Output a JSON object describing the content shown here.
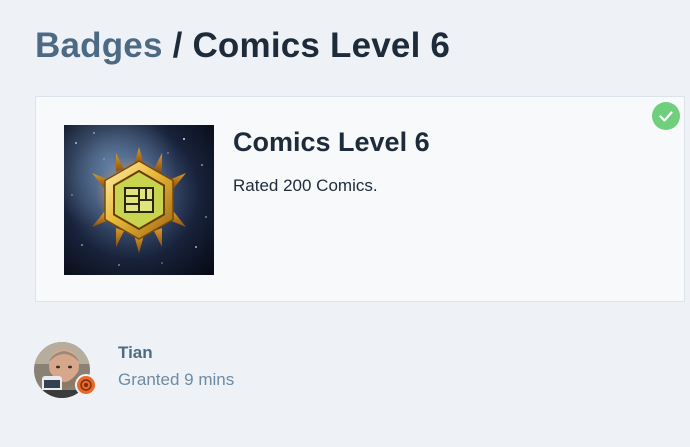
{
  "header": {
    "breadcrumb_label": "Badges",
    "separator": "/",
    "badge_title": "Comics Level 6"
  },
  "badge": {
    "name": "Comics Level 6",
    "description": "Rated 200 Comics.",
    "image_icon": "comic-book-emblem-icon",
    "granted_icon": "checkmark-icon",
    "colors": {
      "granted_check": "#6fcf7c",
      "emblem_gold": "#e8b838",
      "emblem_center": "#c9d44e"
    }
  },
  "grant": {
    "username": "Tian",
    "granted_text": "Granted 9 mins",
    "avatar_icon": "user-avatar",
    "avatar_badge_icon": "flair-badge-icon",
    "colors": {
      "username": "#4d6a85",
      "meta": "#6f8aa3",
      "flair": "#e86a2a"
    }
  }
}
